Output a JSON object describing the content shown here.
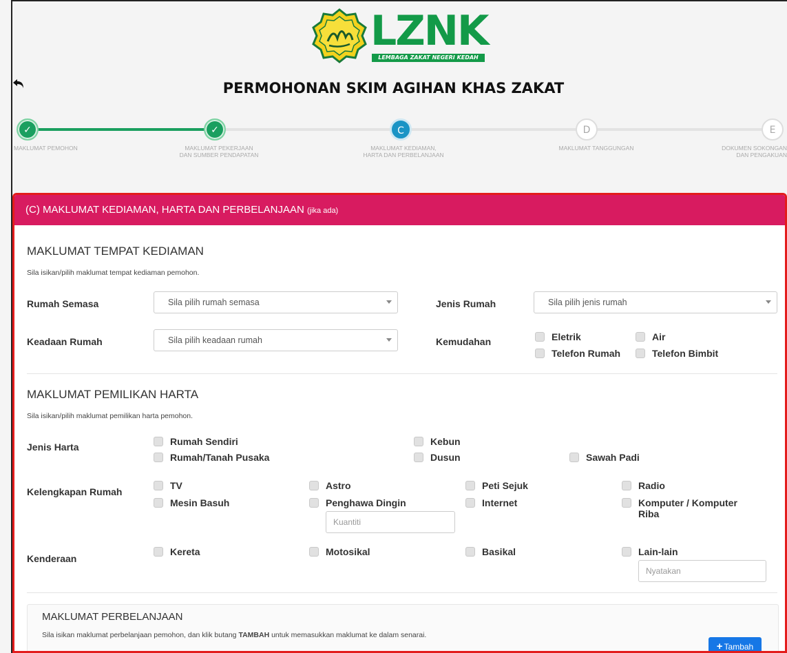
{
  "logo": {
    "brand": "LZNK",
    "subtitle": "LEMBAGA ZAKAT NEGERI KEDAH"
  },
  "page_title": "PERMOHONAN SKIM AGIHAN KHAS ZAKAT",
  "stepper": {
    "steps": [
      {
        "symbol": "✓",
        "label1": "MAKLUMAT PEMOHON",
        "label2": "",
        "state": "done"
      },
      {
        "symbol": "✓",
        "label1": "MAKLUMAT PEKERJAAN",
        "label2": "DAN SUMBER PENDAPATAN",
        "state": "done"
      },
      {
        "symbol": "C",
        "label1": "MAKLUMAT KEDIAMAN,",
        "label2": "HARTA DAN PERBELANJAAN",
        "state": "active"
      },
      {
        "symbol": "D",
        "label1": "MAKLUMAT TANGGUNGAN",
        "label2": "",
        "state": "todo"
      },
      {
        "symbol": "E",
        "label1": "DOKUMEN SOKONGAN",
        "label2": "DAN PENGAKUAN",
        "state": "todo"
      }
    ]
  },
  "colors": {
    "done": "#1a9f5f",
    "active": "#1a94c5",
    "header": "#d81b60",
    "card_border": "#e31c1c",
    "button": "#1677e6"
  },
  "card": {
    "header_main": "(C) MAKLUMAT KEDIAMAN, HARTA DAN PERBELANJAAN",
    "header_note": "(jika ada)"
  },
  "residence": {
    "title": "MAKLUMAT TEMPAT KEDIAMAN",
    "desc": "Sila isikan/pilih maklumat tempat kediaman pemohon.",
    "rumah_semasa_label": "Rumah Semasa",
    "rumah_semasa_placeholder": "Sila pilih rumah semasa",
    "jenis_rumah_label": "Jenis Rumah",
    "jenis_rumah_placeholder": "Sila pilih jenis rumah",
    "keadaan_rumah_label": "Keadaan Rumah",
    "keadaan_rumah_placeholder": "Sila pilih keadaan rumah",
    "kemudahan_label": "Kemudahan",
    "kemudahan": [
      "Eletrik",
      "Air",
      "Telefon Rumah",
      "Telefon Bimbit"
    ]
  },
  "assets": {
    "title": "MAKLUMAT PEMILIKAN HARTA",
    "desc": "Sila isikan/pilih maklumat pemilikan harta pemohon.",
    "jenis_harta_label": "Jenis Harta",
    "jenis_harta": [
      "Rumah Sendiri",
      "Kebun",
      "Rumah/Tanah Pusaka",
      "Dusun",
      "Sawah Padi"
    ],
    "kelengkapan_label": "Kelengkapan Rumah",
    "kelengkapan": [
      "TV",
      "Astro",
      "Peti Sejuk",
      "Radio",
      "Mesin Basuh",
      "Penghawa Dingin",
      "Internet",
      "Komputer / Komputer",
      "Riba"
    ],
    "kuantiti_placeholder": "Kuantiti",
    "kenderaan_label": "Kenderaan",
    "kenderaan": [
      "Kereta",
      "Motosikal",
      "Basikal",
      "Lain-lain"
    ],
    "nyatakan_placeholder": "Nyatakan"
  },
  "expenses": {
    "title": "MAKLUMAT PERBELANJAAN",
    "desc_pre": "Sila isikan maklumat perbelanjaan pemohon, dan klik butang ",
    "desc_bold": "TAMBAH",
    "desc_post": " untuk memasukkan maklumat ke dalam senarai.",
    "button_symbol": "+",
    "button_label": "Tambah"
  }
}
